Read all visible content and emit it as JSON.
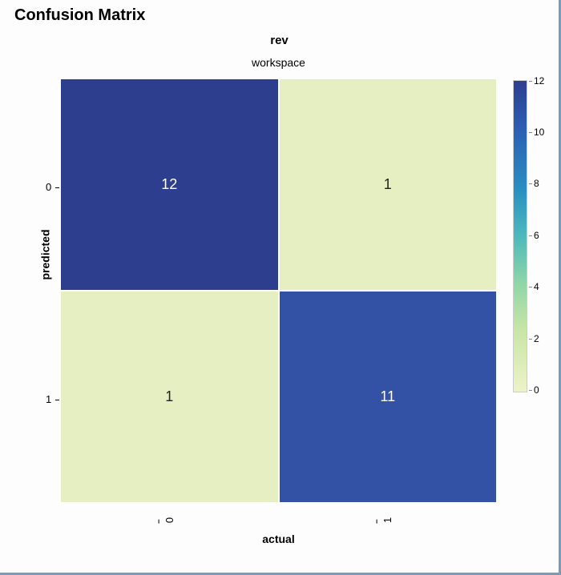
{
  "title": "Confusion Matrix",
  "column_header": "rev",
  "facet_title": "workspace",
  "ylabel": "predicted",
  "xlabel": "actual",
  "y_ticks": [
    "0",
    "1"
  ],
  "x_ticks": [
    "0",
    "1"
  ],
  "cells": {
    "r0c0": "12",
    "r0c1": "1",
    "r1c0": "1",
    "r1c1": "11"
  },
  "cb_ticks": {
    "t12": "12",
    "t10": "10",
    "t8": "8",
    "t6": "6",
    "t4": "4",
    "t2": "2",
    "t0": "0"
  },
  "chart_data": {
    "type": "heatmap",
    "title": "Confusion Matrix",
    "column_header": "rev",
    "facet": "workspace",
    "xlabel": "actual",
    "ylabel": "predicted",
    "x_categories": [
      "0",
      "1"
    ],
    "y_categories": [
      "0",
      "1"
    ],
    "matrix": [
      [
        12,
        1
      ],
      [
        1,
        11
      ]
    ],
    "colorbar_range": [
      0,
      12
    ],
    "colorbar_ticks": [
      0,
      2,
      4,
      6,
      8,
      10,
      12
    ]
  }
}
